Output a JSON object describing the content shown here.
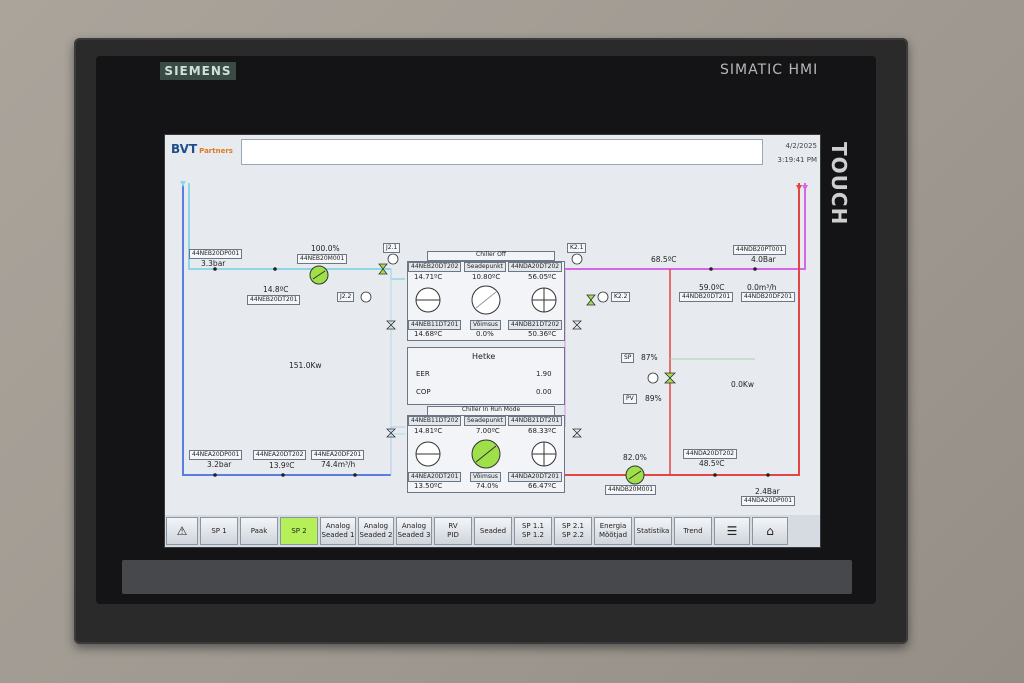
{
  "device": {
    "brand": "SIEMENS",
    "model": "SIMATIC HMI",
    "side_label": "TOUCH"
  },
  "header": {
    "logo_main": "BVT",
    "logo_sub": "Partners",
    "date": "4/2/2025",
    "time": "3:19:41 PM"
  },
  "colors": {
    "supply_blue": "#5a7de0",
    "cyan": "#8fd7e6",
    "magenta": "#d765e6",
    "red": "#e34545",
    "green_fill": "#9fe04a"
  },
  "left": {
    "dp1_tag": "44NEB20DP001",
    "dp1_val": "3.3bar",
    "pump_pct": "100.0%",
    "pump_tag": "44NEB20M001",
    "dt_val": "14.8ºC",
    "dt_tag": "44NEB20DT201",
    "power": "151.0Kw",
    "dp2_tag": "44NEA20DP001",
    "dp2_val": "3.2bar",
    "dt2_tag": "44NEA20DT202",
    "dt2_val": "13.9ºC",
    "df_tag": "44NEA20DF201",
    "df_val": "74.4m³/h",
    "valve1": "J2.1",
    "valve2": "J2.2"
  },
  "chiller_top": {
    "status": "Chiller Off",
    "tag_left": "44NEB20DT202",
    "label_mid": "Seadepunkt",
    "tag_right": "44NDA20DT202",
    "val_left": "14.71ºC",
    "val_mid": "10.80ºC",
    "val_right": "56.05ºC",
    "tag_left2": "44NEB11DT201",
    "label_mid2": "Võimsus",
    "tag_right2": "44NDB21DT202",
    "val_left2": "14.68ºC",
    "val_mid2": "0.0%",
    "val_right2": "50.36ºC"
  },
  "hetke": {
    "title": "Hetke",
    "eer_label": "EER",
    "eer_val": "1.90",
    "cop_label": "COP",
    "cop_val": "0.00"
  },
  "chiller_bottom": {
    "status": "Chiller In Run Mode",
    "tag_left": "44NEB11DT202",
    "label_mid": "Seadepunkt",
    "tag_right": "44NDB21DT201",
    "val_left": "14.81ºC",
    "val_mid": "7.00ºC",
    "val_right": "68.33ºC",
    "tag_left2": "44NEA20DT201",
    "label_mid2": "Võimsus",
    "tag_right2": "44NDA20DT201",
    "val_left2": "13.50ºC",
    "val_mid2": "74.0%",
    "val_right2": "66.47ºC"
  },
  "right": {
    "valve_k": "K2.1",
    "valve_k2": "K2.2",
    "temp_top": "68.5ºC",
    "pt_tag": "44NDB20PT001",
    "pt_val": "4.0Bar",
    "dt_val": "59.0ºC",
    "dt_tag": "44NDB20DT201",
    "df_val": "0.0m³/h",
    "df_tag": "44NDB20DF201",
    "sp_label": "SP",
    "sp_val": "87%",
    "pv_label": "PV",
    "pv_val": "89%",
    "power": "0.0Kw",
    "pump_pct": "82.0%",
    "pump_tag": "44NDB20M001",
    "dt2_tag": "44NDA20DT202",
    "dt2_val": "48.5ºC",
    "bar_val": "2.4Bar",
    "bar_tag": "44NDA20DP001"
  },
  "nav": [
    "SP 1",
    "Paak",
    "SP 2",
    "Analog\nSeaded 1",
    "Analog\nSeaded 2",
    "Analog\nSeaded 3",
    "RV\nPID",
    "Seaded",
    "SP 1.1\nSP 1.2",
    "SP 2.1\nSP 2.2",
    "Energia\nMõõtjad",
    "Statistika",
    "Trend"
  ],
  "nav_active": "SP 2"
}
